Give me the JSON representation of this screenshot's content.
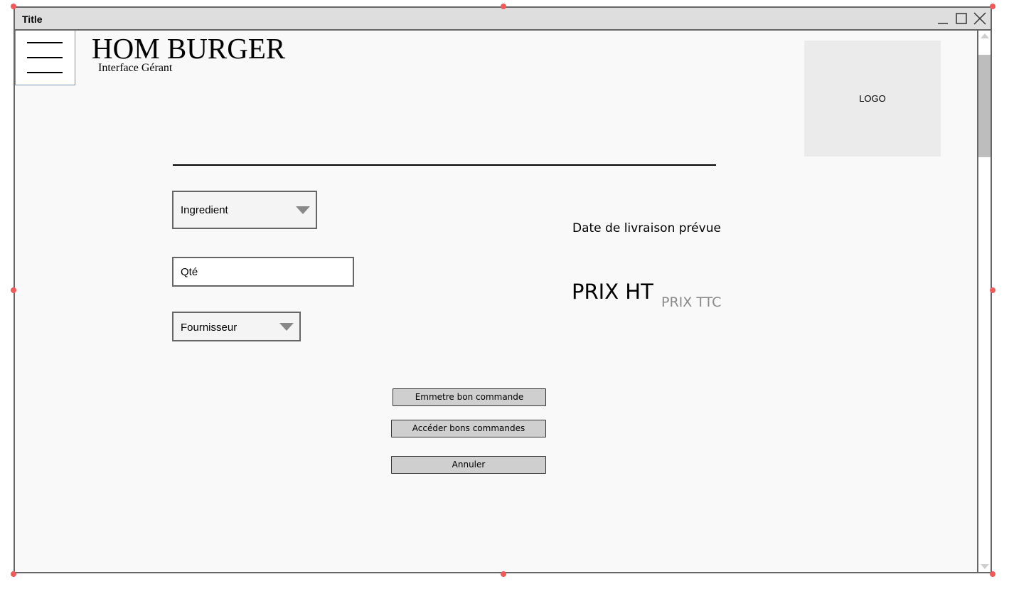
{
  "window": {
    "title": "Title"
  },
  "header": {
    "brand": "HOM BURGER",
    "subtitle": "Interface Gérant",
    "logo_text": "LOGO"
  },
  "form": {
    "ingredient_select": "Ingredient",
    "quantity_placeholder": "Qté",
    "fournisseur_select": "Fournisseur"
  },
  "info": {
    "delivery_date_label": "Date de livraison prévue",
    "price_ht": "PRIX HT",
    "price_ttc": "PRIX TTC"
  },
  "buttons": {
    "emit": "Emmetre bon commande",
    "access": "Accéder bons commandes",
    "cancel": "Annuler"
  },
  "colors": {
    "titlebar": "#dedede",
    "canvas": "#f9f9f9",
    "button": "#cfcfcf",
    "handle": "#ef5b5b"
  }
}
